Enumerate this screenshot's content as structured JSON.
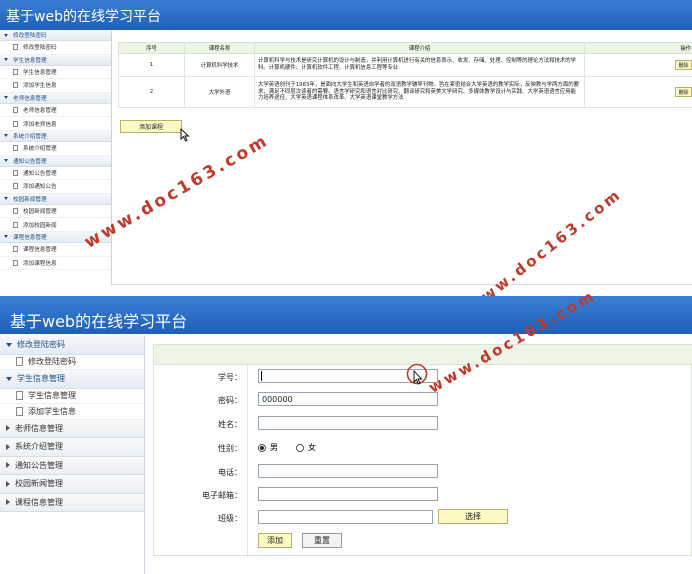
{
  "top": {
    "app_title": "基于web的在线学习平台",
    "sidebar": [
      {
        "label": "修改登陆密码",
        "items": [
          "修改登陆密码"
        ]
      },
      {
        "label": "学生信息管理",
        "items": [
          "学生信息管理",
          "添加学生信息"
        ]
      },
      {
        "label": "老师信息管理",
        "items": [
          "老师信息管理",
          "添加老师信息"
        ]
      },
      {
        "label": "系统介绍管理",
        "items": [
          "系统介绍管理"
        ]
      },
      {
        "label": "通知公告管理",
        "items": [
          "通知公告管理",
          "添加通知公告"
        ]
      },
      {
        "label": "校园新闻管理",
        "items": [
          "校园新闻管理",
          "添加校园新闻"
        ]
      },
      {
        "label": "课程信息管理",
        "items": [
          "课程信息管理",
          "添加课程信息"
        ]
      }
    ],
    "table": {
      "headers": [
        "序号",
        "课程名称",
        "课程介绍",
        "操作"
      ],
      "rows": [
        {
          "no": "1",
          "name": "计算机科学技术",
          "intro": "计算机科学与技术是研究计算机的设计与制造，并利用计算机进行有关的信息表示、收发、存储、处理、控制等的理论方法和技术的学科。计算机硬件、计算机软件工程、计算机信息工程等专业",
          "action": "删除"
        },
        {
          "no": "2",
          "name": "大学外语",
          "intro": "大学英语创刊于1983年，是面向大学生和英语自学者的双语教学辅导刊物。旨在紧密结合大学英语的教学实际，反映教与学两方面的要求，满足不同层次读者的需要。语言学研究和语言对比研究、翻译研究和英美文学研究、多媒体教学设计与实践、大学英语语言应用能力培养途径、大学英语课程体系改革、大学英语课堂教学方法",
          "action": "删除"
        }
      ]
    },
    "add_button": "添加课程"
  },
  "bottom": {
    "app_title": "基于web的在线学习平台",
    "sidebar": [
      {
        "label": "修改登陆密码",
        "expanded": true,
        "items": [
          "修改登陆密码"
        ]
      },
      {
        "label": "学生信息管理",
        "expanded": true,
        "items": [
          "学生信息管理",
          "添加学生信息"
        ]
      },
      {
        "label": "老师信息管理",
        "expanded": false,
        "items": []
      },
      {
        "label": "系统介绍管理",
        "expanded": false,
        "items": []
      },
      {
        "label": "通知公告管理",
        "expanded": false,
        "items": []
      },
      {
        "label": "校园新闻管理",
        "expanded": false,
        "items": []
      },
      {
        "label": "课程信息管理",
        "expanded": false,
        "items": []
      }
    ],
    "form": {
      "student_no": {
        "label": "学号：",
        "value": ""
      },
      "password": {
        "label": "密码：",
        "value": "000000"
      },
      "name": {
        "label": "姓名：",
        "value": ""
      },
      "gender": {
        "label": "性别：",
        "options": [
          "男",
          "女"
        ],
        "selected": "男"
      },
      "phone": {
        "label": "电话：",
        "value": ""
      },
      "email": {
        "label": "电子邮箱：",
        "value": ""
      },
      "class": {
        "label": "班级：",
        "value": "",
        "select_button": "选择"
      },
      "submit": "添加",
      "reset": "重置"
    }
  },
  "watermark": "www.doc163.com",
  "colors": {
    "title_bar": "#2b6fc9",
    "button_fill": "#fdf9c4",
    "watermark": "#c0392b"
  }
}
